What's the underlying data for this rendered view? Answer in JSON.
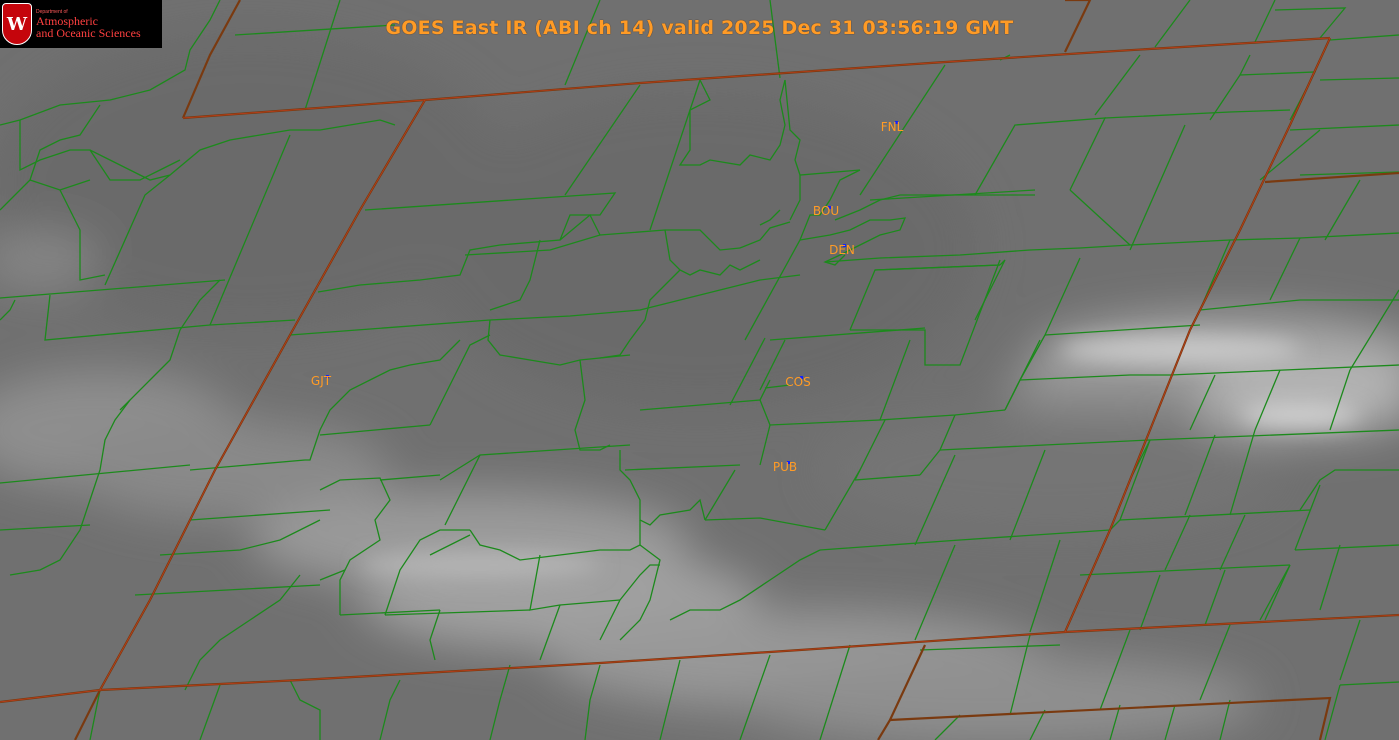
{
  "title": "GOES East IR (ABI ch 14) valid 2025 Dec 31 03:56:19 GMT",
  "logo": {
    "crest_letter": "W",
    "line_small": "Department of",
    "line1": "Atmospheric",
    "line2": "and Oceanic Sciences"
  },
  "stations": [
    {
      "id": "FNL",
      "label": "FNL"
    },
    {
      "id": "BOU",
      "label": "BOU"
    },
    {
      "id": "DEN",
      "label": "DEN"
    },
    {
      "id": "GJT",
      "label": "GJT"
    },
    {
      "id": "COS",
      "label": "COS"
    },
    {
      "id": "PUB",
      "label": "PUB"
    }
  ],
  "colors": {
    "county_lines": "#1c8a1c",
    "state_lines": "#7a3a10",
    "labels": "#ff9b26",
    "station_marker": "#1020ff"
  }
}
